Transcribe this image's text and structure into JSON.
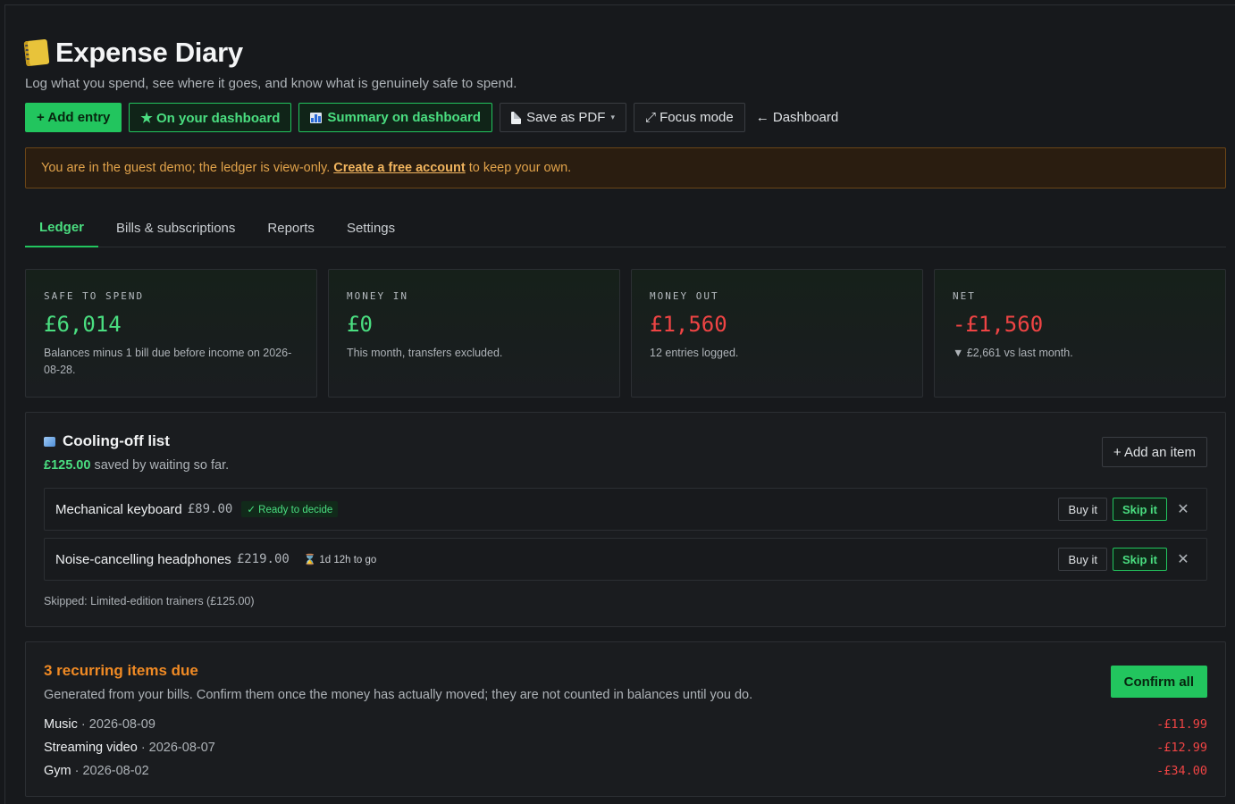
{
  "app": {
    "title": "Expense Diary",
    "subtitle": "Log what you spend, see where it goes, and know what is genuinely safe to spend."
  },
  "toolbar": {
    "add_entry": "+ Add entry",
    "on_dashboard": "★ On your dashboard",
    "summary_dashboard": "Summary on dashboard",
    "save_pdf": "Save as PDF",
    "caret": "▾",
    "focus_mode": "⤢ Focus mode",
    "dashboard": "← Dashboard"
  },
  "banner": {
    "prefix": "You are in the guest demo; the ledger is view-only.",
    "link": "Create a free account",
    "suffix": "to keep your own."
  },
  "tabs": [
    {
      "label": "Ledger",
      "active": true
    },
    {
      "label": "Bills & subscriptions",
      "active": false
    },
    {
      "label": "Reports",
      "active": false
    },
    {
      "label": "Settings",
      "active": false
    }
  ],
  "stats": [
    {
      "label": "SAFE TO SPEND",
      "value": "£6,014",
      "note": "Balances minus 1 bill due before income on 2026-08-28.",
      "tone": "green"
    },
    {
      "label": "MONEY IN",
      "value": "£0",
      "note": "This month, transfers excluded.",
      "tone": "green"
    },
    {
      "label": "MONEY OUT",
      "value": "£1,560",
      "note": "12 entries logged.",
      "tone": "red"
    },
    {
      "label": "NET",
      "value": "-£1,560",
      "note": "▼ £2,661 vs last month.",
      "tone": "red"
    }
  ],
  "cooling": {
    "title": "Cooling-off list",
    "saved_amount": "£125.00",
    "saved_text": "saved by waiting so far.",
    "add_item": "+ Add an item",
    "buy_label": "Buy it",
    "skip_label": "Skip it",
    "close_glyph": "✕",
    "items": [
      {
        "name": "Mechanical keyboard",
        "price": "£89.00",
        "status": "✓ Ready to decide"
      },
      {
        "name": "Noise-cancelling headphones",
        "price": "£219.00",
        "status": "⌛ 1d 12h to go"
      }
    ],
    "skipped": "Skipped: Limited-edition trainers (£125.00)"
  },
  "recurring": {
    "title": "3 recurring items due",
    "description": "Generated from your bills. Confirm them once the money has actually moved; they are not counted in balances until you do.",
    "confirm_all": "Confirm all",
    "items": [
      {
        "name": "Music",
        "date": "· 2026-08-09",
        "amount": "-£11.99"
      },
      {
        "name": "Streaming video",
        "date": "· 2026-08-07",
        "amount": "-£12.99"
      },
      {
        "name": "Gym",
        "date": "· 2026-08-02",
        "amount": "-£34.00"
      }
    ]
  },
  "colors": {
    "accent": "#22c55e",
    "danger": "#ef4444",
    "warning": "#f08a24",
    "background": "#17191c"
  }
}
